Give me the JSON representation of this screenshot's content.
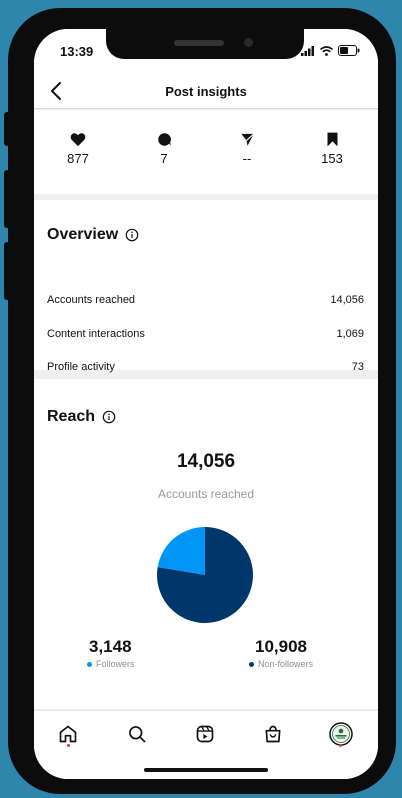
{
  "status_bar": {
    "time": "13:39"
  },
  "header": {
    "title": "Post insights"
  },
  "stats": [
    {
      "icon": "heart-icon",
      "value": "877"
    },
    {
      "icon": "comment-icon",
      "value": "7"
    },
    {
      "icon": "share-icon",
      "value": "--"
    },
    {
      "icon": "save-icon",
      "value": "153"
    }
  ],
  "overview": {
    "title": "Overview",
    "rows": [
      {
        "label": "Accounts reached",
        "value": "14,056"
      },
      {
        "label": "Content interactions",
        "value": "1,069"
      },
      {
        "label": "Profile activity",
        "value": "73"
      }
    ]
  },
  "reach": {
    "title": "Reach",
    "total": "14,056",
    "total_label": "Accounts reached",
    "followers": {
      "value": "3,148",
      "label": "Followers",
      "color": "#0095f6"
    },
    "non_followers": {
      "value": "10,908",
      "label": "Non-followers",
      "color": "#00376b"
    }
  },
  "chart_data": {
    "type": "pie",
    "slices": [
      {
        "name": "Followers",
        "value": 3148,
        "color": "#0095f6"
      },
      {
        "name": "Non-followers",
        "value": 10908,
        "color": "#00376b"
      }
    ]
  },
  "tabbar": [
    {
      "icon": "home-icon",
      "notify": true
    },
    {
      "icon": "search-icon",
      "notify": false
    },
    {
      "icon": "reels-icon",
      "notify": false
    },
    {
      "icon": "shop-icon",
      "notify": false
    },
    {
      "icon": "profile-avatar",
      "notify": true
    }
  ]
}
